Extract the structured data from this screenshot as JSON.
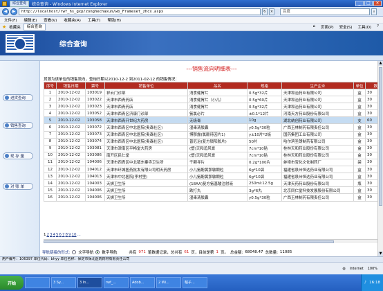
{
  "window": {
    "title": "综合查询 - Windows Internet Explorer",
    "tab_title": "综合查询"
  },
  "browser": {
    "address": "http://localhost/rwf_hs_gxp/zonghechaxun/wb_Frameset_zhcx.aspx",
    "search_placeholder": "百度",
    "menu": [
      "文件(F)",
      "编辑(E)",
      "查看(V)",
      "收藏夹(A)",
      "工具(T)",
      "帮助(H)"
    ],
    "favorites_label": "收藏夹",
    "tab_label": "综合查询",
    "tools": [
      "页面(P)",
      "安全(S)",
      "工具(O)"
    ]
  },
  "banner": {
    "title": "综合查询"
  },
  "sidebar": {
    "items": [
      {
        "label": "进货查询"
      },
      {
        "label": "销售查询"
      },
      {
        "label": "现 存 量"
      },
      {
        "label": "对 账 单"
      }
    ]
  },
  "report": {
    "title": "---销售流向明细表---",
    "description": "货源为该单位的销售流向，查询日期以2010-12-2 到2011-02-12 的销售情况："
  },
  "table": {
    "columns": [
      "序号",
      "销售日期",
      "票号",
      "销售单位",
      "品名",
      "规格",
      "生产企业",
      "单位",
      "数量"
    ],
    "rows": [
      [
        "1",
        "2010-12-02",
        "103019",
        "祥云门诊部",
        "消食健胃片",
        "0.5g*32片",
        "天津和治药业有限公司",
        "盒",
        "30"
      ],
      [
        "2",
        "2010-12-02",
        "103022",
        "天津市西青药店",
        "消食健胃片（小儿）",
        "0.5g*60片",
        "天津和治药业有限公司",
        "盒",
        "30"
      ],
      [
        "3",
        "2010-12-02",
        "103023",
        "天津市西青药店",
        "消食健胃片",
        "0.5g*32片",
        "天津和治药业有限公司",
        "盒",
        "30"
      ],
      [
        "4",
        "2010-12-02",
        "103052",
        "天津市西青区济康门诊部",
        "氨氯必片",
        "±0.1*12片",
        "河南天方药业股份有限公司",
        "盒",
        "30"
      ],
      [
        "5",
        "2010-12-02",
        "103058",
        "天津市西青开世纪大药房",
        "无极膏",
        "10g",
        "湖北统创药业有限公司",
        "支",
        "60"
      ],
      [
        "6",
        "2010-12-02",
        "103072",
        "天津市西青区中北医院(奥森社区)",
        "湿毒清胶囊",
        "y0.5g*30粒",
        "广西玉林制药有限责任公司",
        "盒",
        "30"
      ],
      [
        "7",
        "2010-12-02",
        "103073",
        "天津市西青区中北医院(奥森社区)",
        "博那露(氯酚待因片1)",
        "y±10片*2板",
        "国药集团工业有限公司",
        "盒",
        "30"
      ],
      [
        "8",
        "2010-12-02",
        "103074",
        "天津市西青区中北医院(奥森社区)",
        "普厄治(复方锁阳胶片)",
        "50片",
        "哈尔滨圣朗制药有限公司",
        "盒",
        "30"
      ],
      [
        "9",
        "2010-12-02",
        "103081",
        "天津市津南区平畅堂大药房",
        "(塑)天和追风膏",
        "7cm*10贴",
        "桂林天和药业股份有限公司",
        "盒",
        "30"
      ],
      [
        "10",
        "2010-12-02",
        "103086",
        "南开区民仁堂",
        "(塑)天和追风膏",
        "7cm*10贴",
        "桂林天和药业股份有限公司",
        "盒",
        "30"
      ],
      [
        "11",
        "2010-12-02",
        "104006",
        "天津市西青区中北镇东秦寺卫生所",
        "千颗寻片",
        "0.2g*100片",
        "蚌埠市宝化文化制药厂",
        "袋",
        "30"
      ],
      [
        "12",
        "2010-12-02",
        "104012",
        "天津市环城医药批发有限公司明天药房",
        "小儿氨酚黄那敏颗粒",
        "6g*10袋",
        "福建省泉州恒达药业有限公司",
        "盒",
        "30"
      ],
      [
        "13",
        "2010-12-02",
        "104013",
        "天津市中北医院(李村里)",
        "小儿氨酚黄那敏颗粒",
        "6g*10袋",
        "福建省泉州恒达药业有限公司",
        "盒",
        "30"
      ],
      [
        "14",
        "2010-12-02",
        "104003",
        "天狮卫生所",
        "(18AA)复方氨基酸注射液",
        "250ml:12.5g",
        "天津天药药业股份有限公司",
        "瓶",
        "30"
      ],
      [
        "15",
        "2010-12-02",
        "104006",
        "天狮卫生所",
        "跌打丸",
        "3g*6丸",
        "北京同仁堂科技发展股份有限公司",
        "盒",
        "30"
      ],
      [
        "16",
        "2010-12-02",
        "104006",
        "天狮卫生所",
        "湿毒清胶囊",
        "y0.5g*30粒",
        "广西玉林制药有限责任公司",
        "盒",
        "30"
      ]
    ],
    "highlight_row": 5
  },
  "pager": {
    "pages": [
      "1",
      "2",
      "3",
      "4",
      "5",
      "6",
      "7",
      "8",
      "9",
      "10"
    ],
    "ellipsis": "...",
    "current": "1"
  },
  "footer": {
    "nav_label": "导航链接的形式:",
    "option_text": "文字导航",
    "option_numeric": "数字导航",
    "summary_prefix": "共有",
    "total_records": "971",
    "summary_mid": "笔数据记录，总共有",
    "total_pages": "61",
    "summary_mid2": "页，目前是第",
    "current_page": "1",
    "summary_suffix": "页。",
    "total_amount_label": "总金额:",
    "total_amount": "68048.47",
    "total_qty_label": "总数量:",
    "total_qty": "11085"
  },
  "status_bar": {
    "text": "用户编号：106397  单位代码：bhyy  单位名称：保定市保北医药药材有限责任公司"
  },
  "ie_status": {
    "zone": "Internet",
    "zoom": "100%"
  },
  "taskbar": {
    "start": "开始",
    "items": [
      "",
      "3 Sy...",
      "3 In...",
      "rwf_...",
      "Adob...",
      "2 Wi...",
      "稻子..."
    ],
    "clock": "16:18"
  }
}
